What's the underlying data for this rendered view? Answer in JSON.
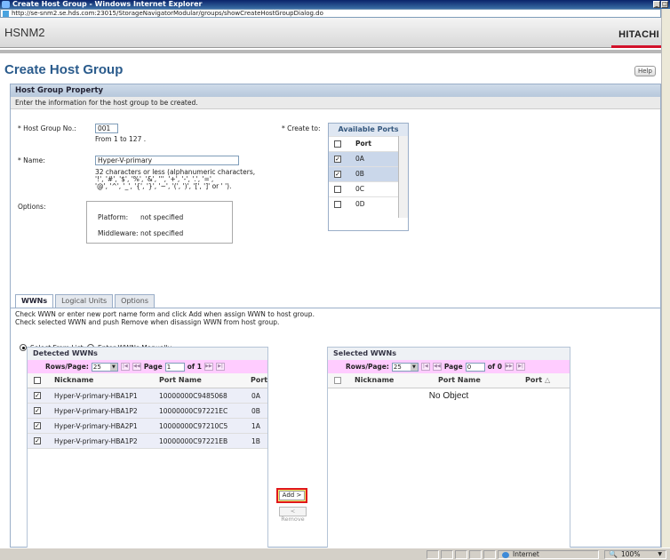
{
  "window": {
    "title": "Create Host Group - Windows Internet Explorer",
    "url": "http://se-snm2.se.hds.com:23015/StorageNavigatorModular/groups/showCreateHostGroupDialog.do"
  },
  "app": {
    "name": "HSNM2",
    "brand": "HITACHI",
    "brand_color": "#d2112a"
  },
  "page": {
    "title": "Create Host Group",
    "help_label": "Help"
  },
  "section": {
    "title": "Host Group Property",
    "description": "Enter the information for the host group to be created."
  },
  "form": {
    "host_group_no_label": "* Host Group No.:",
    "host_group_no_value": "001",
    "host_group_no_hint": "From 1 to 127 .",
    "name_label": "* Name:",
    "name_value": "Hyper-V-primary",
    "name_hint_1": "32 characters or less (alphanumeric characters,",
    "name_hint_2": "'!', '#', '$', '%', '&', ''', '+', '-', '.', '=',",
    "name_hint_3": "'@', '^', '_', '{', '}', '~', '(', ')', '[', ']' or ' ').",
    "options_label": "Options:",
    "platform_label": "Platform:",
    "platform_value": "not specified",
    "middleware_label": "Middleware:",
    "middleware_value": "not specified",
    "create_to_label": "* Create to:"
  },
  "ports": {
    "title": "Available Ports",
    "column": "Port",
    "rows": [
      {
        "port": "0A",
        "checked": true
      },
      {
        "port": "0B",
        "checked": true
      },
      {
        "port": "0C",
        "checked": false
      },
      {
        "port": "0D",
        "checked": false
      }
    ]
  },
  "tabs": [
    {
      "label": "WWNs"
    },
    {
      "label": "Logical Units"
    },
    {
      "label": "Options"
    }
  ],
  "wwns": {
    "desc_1": "Check WWN or enter new port name form and click Add when assign WWN to host group.",
    "desc_2": "Check selected WWN and push Remove when disassign WWN from host group.",
    "radio_list": "Select From List",
    "radio_manual": "Enter WWNs Manually",
    "detected": {
      "title": "Detected WWNs",
      "rows_per_page_label": "Rows/Page:",
      "rows_per_page": "25",
      "page_label": "Page",
      "page_value": "1",
      "of_label": "of 1",
      "columns": [
        "Nickname",
        "Port Name",
        "Port"
      ],
      "rows": [
        {
          "nickname": "Hyper-V-primary-HBA1P1",
          "port_name": "10000000C9485068",
          "port": "0A"
        },
        {
          "nickname": "Hyper-V-primary-HBA1P2",
          "port_name": "10000000C97221EC",
          "port": "0B"
        },
        {
          "nickname": "Hyper-V-primary-HBA2P1",
          "port_name": "10000000C97210C5",
          "port": "1A"
        },
        {
          "nickname": "Hyper-V-primary-HBA1P2",
          "port_name": "10000000C97221EB",
          "port": "1B"
        }
      ]
    },
    "selected": {
      "title": "Selected WWNs",
      "rows_per_page_label": "Rows/Page:",
      "rows_per_page": "25",
      "page_label": "Page",
      "page_value": "0",
      "of_label": "of 0",
      "columns": [
        "Nickname",
        "Port Name",
        "Port"
      ],
      "sort_icon": "△",
      "empty": "No Object"
    },
    "add_label": "Add >",
    "remove_label": "< Remove"
  },
  "statusbar": {
    "zone": "Internet",
    "zoom": "100%"
  }
}
